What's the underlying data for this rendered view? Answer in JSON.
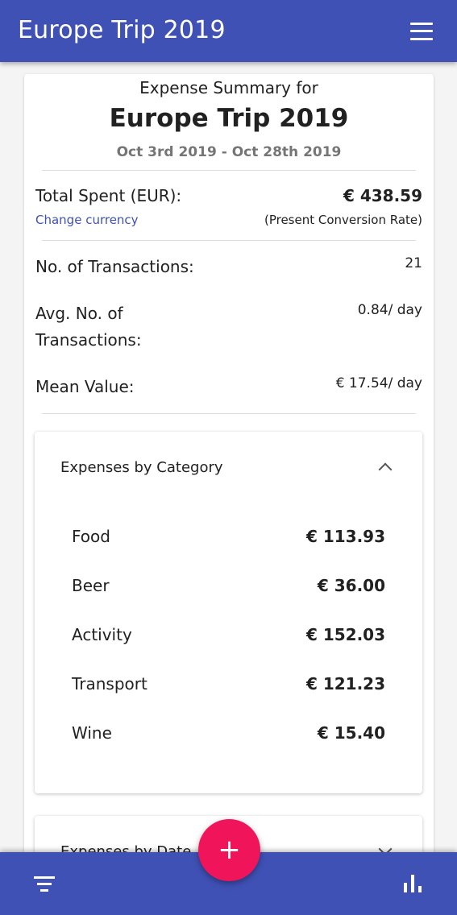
{
  "app_bar": {
    "title": "Europe Trip 2019",
    "menu_icon": "hamburger-menu-icon"
  },
  "summary": {
    "heading": "Expense Summary for",
    "trip_name": "Europe Trip 2019",
    "date_range": "Oct 3rd 2019 - Oct 28th 2019",
    "total_label": "Total Spent (EUR):",
    "total_value": "€ 438.59",
    "change_currency": "Change currency",
    "conversion_note": "(Present Conversion Rate)",
    "stats": [
      {
        "label": "No. of Transactions:",
        "value": "21"
      },
      {
        "label": "Avg. No. of Transactions:",
        "value": "0.84/ day"
      },
      {
        "label": "Mean Value:",
        "value": "€ 17.54/ day"
      }
    ]
  },
  "category_panel": {
    "title": "Expenses by Category",
    "expanded": true,
    "items": [
      {
        "name": "Food",
        "amount": "€ 113.93"
      },
      {
        "name": "Beer",
        "amount": "€ 36.00"
      },
      {
        "name": "Activity",
        "amount": "€ 152.03"
      },
      {
        "name": "Transport",
        "amount": "€ 121.23"
      },
      {
        "name": "Wine",
        "amount": "€ 15.40"
      }
    ]
  },
  "date_panel": {
    "title": "Expenses by Date",
    "expanded": false
  },
  "bottom_bar": {
    "left_icon": "filter-icon",
    "right_icon": "bar-chart-icon",
    "fab_icon": "add-icon",
    "fab_label": "+"
  },
  "colors": {
    "primary": "#3f51b5",
    "accent": "#f0145a",
    "link": "#3f51b5",
    "muted_text": "#757575"
  }
}
